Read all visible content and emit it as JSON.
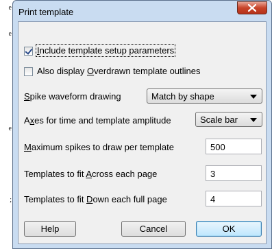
{
  "background_text": [
    "e",
    "e",
    "",
    "",
    "",
    "",
    "e",
    "",
    "",
    "",
    "",
    "",
    ";",
    "",
    "",
    "",
    ""
  ],
  "window": {
    "title": "Print template",
    "close_label": "X"
  },
  "options": {
    "include_setup": {
      "label": "Include template setup parameters",
      "checked": true
    },
    "overdrawn": {
      "label_pre": "Also display ",
      "label_u": "O",
      "label_post": "verdrawn template outlines",
      "checked": false
    }
  },
  "spike_drawing": {
    "label_u": "S",
    "label_rest": "pike waveform drawing",
    "value": "Match by shape"
  },
  "axes": {
    "label_pre": "A",
    "label_u": "x",
    "label_post": "es for time and template amplitude",
    "value": "Scale bar"
  },
  "max_spikes": {
    "label_u": "M",
    "label_rest": "aximum spikes to draw per template",
    "value": "500"
  },
  "across": {
    "label_pre": "Templates to fit ",
    "label_u": "A",
    "label_post": "cross each page",
    "value": "3"
  },
  "down": {
    "label_pre": "Templates to fit ",
    "label_u": "D",
    "label_post": "own each full page",
    "value": "4"
  },
  "buttons": {
    "help": "Help",
    "cancel": "Cancel",
    "ok": "OK"
  }
}
